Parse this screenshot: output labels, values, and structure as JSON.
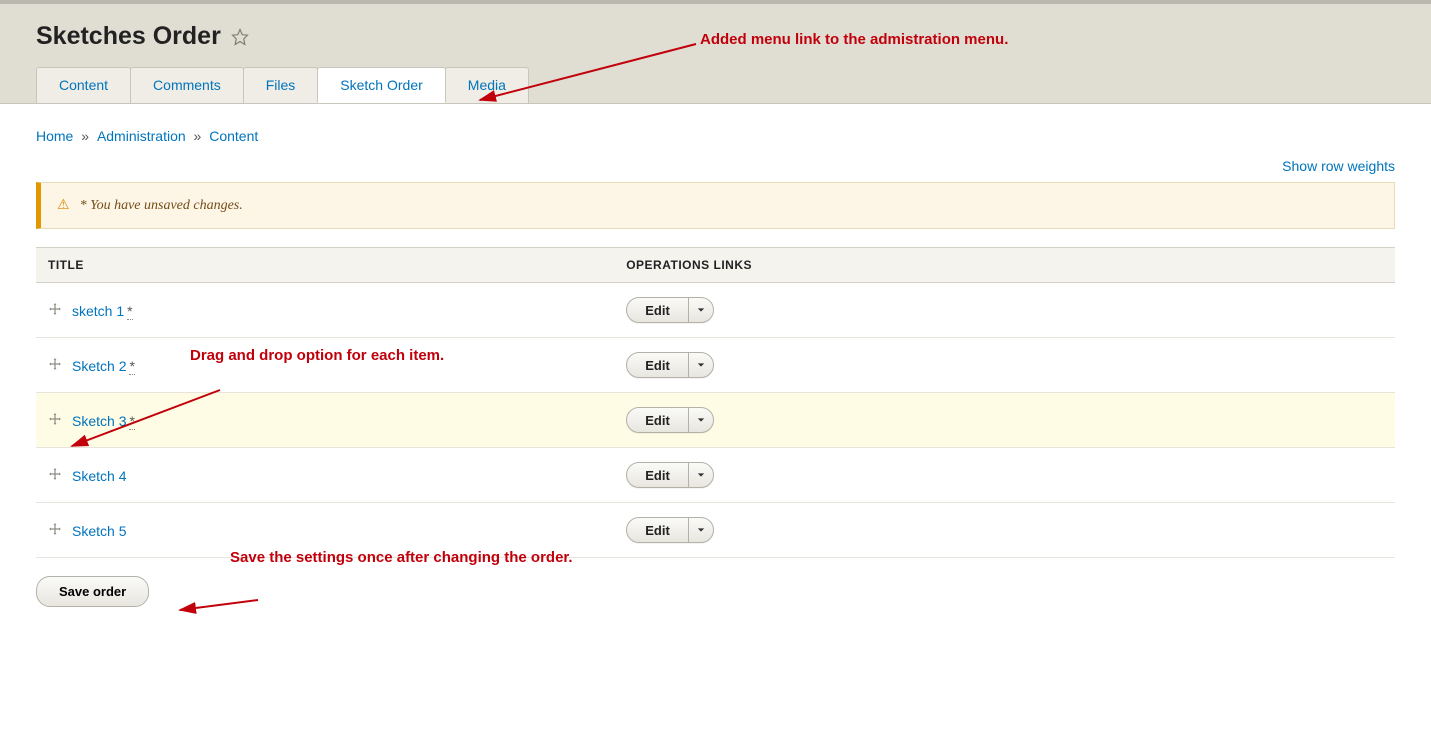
{
  "header": {
    "page_title": "Sketches Order"
  },
  "tabs": [
    {
      "label": "Content",
      "active": false
    },
    {
      "label": "Comments",
      "active": false
    },
    {
      "label": "Files",
      "active": false
    },
    {
      "label": "Sketch Order",
      "active": true
    },
    {
      "label": "Media",
      "active": false
    }
  ],
  "breadcrumbs": {
    "items": [
      "Home",
      "Administration",
      "Content"
    ],
    "separator": "»"
  },
  "show_weights_label": "Show row weights",
  "warning": {
    "text": "* You have unsaved changes."
  },
  "table": {
    "headers": {
      "title": "TITLE",
      "operations": "OPERATIONS LINKS"
    },
    "edit_label": "Edit",
    "rows": [
      {
        "title": "sketch 1",
        "changed": true,
        "highlight": false
      },
      {
        "title": "Sketch 2",
        "changed": true,
        "highlight": false
      },
      {
        "title": "Sketch 3",
        "changed": true,
        "highlight": true
      },
      {
        "title": "Sketch 4",
        "changed": false,
        "highlight": false
      },
      {
        "title": "Sketch 5",
        "changed": false,
        "highlight": false
      }
    ]
  },
  "save_button_label": "Save order",
  "annotations": {
    "menu_link": "Added menu link to the admistration menu.",
    "drag_drop": "Drag and drop option for each item.",
    "save_settings": "Save the settings once after changing the order."
  }
}
